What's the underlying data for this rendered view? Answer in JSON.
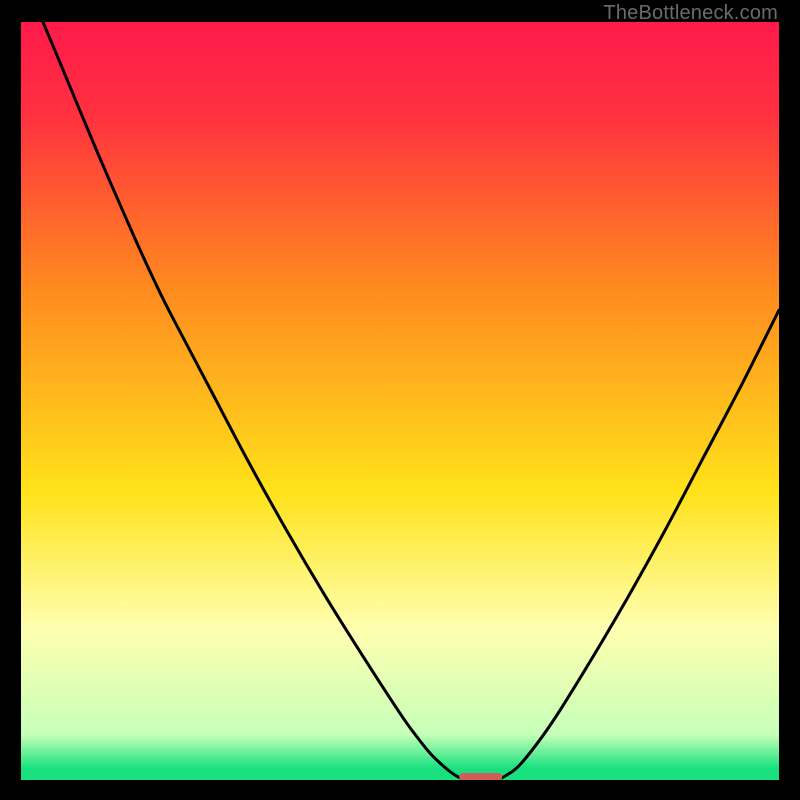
{
  "watermark": "TheBottleneck.com",
  "colors": {
    "red": "#ff1a4b",
    "orange": "#ff8a1f",
    "yellow": "#ffe21a",
    "pale_yellow": "#ffffb0",
    "green": "#18e07e",
    "marker": "#cf5e54",
    "black": "#000000"
  },
  "chart_data": {
    "type": "line",
    "title": "",
    "xlabel": "",
    "ylabel": "",
    "xlim": [
      0,
      100
    ],
    "ylim": [
      0,
      100
    ],
    "series": [
      {
        "name": "left-curve",
        "x": [
          2.9,
          5,
          10,
          15,
          18,
          20,
          25,
          30,
          35,
          40,
          45,
          50,
          52,
          54,
          56,
          57.5,
          58.5
        ],
        "y": [
          100,
          95,
          83,
          71.5,
          65,
          61,
          51.5,
          42,
          33,
          24.5,
          16.5,
          8.8,
          6,
          3.5,
          1.6,
          0.5,
          0.1
        ]
      },
      {
        "name": "right-curve",
        "x": [
          63,
          64,
          66,
          70,
          75,
          80,
          85,
          90,
          95,
          100
        ],
        "y": [
          0.1,
          0.6,
          2.2,
          7.5,
          15.5,
          24,
          33,
          42.5,
          52,
          62
        ]
      }
    ],
    "marker": {
      "name": "bottleneck-marker",
      "x_start": 57.8,
      "x_end": 63.5,
      "y": 0.4
    },
    "gradient_stops": [
      {
        "pct": 0,
        "color": "#ff1a4b"
      },
      {
        "pct": 12,
        "color": "#ff3040"
      },
      {
        "pct": 35,
        "color": "#ff8a1f"
      },
      {
        "pct": 62,
        "color": "#ffe21a"
      },
      {
        "pct": 80,
        "color": "#ffffb0"
      },
      {
        "pct": 94,
        "color": "#c6ffb8"
      },
      {
        "pct": 98.5,
        "color": "#18e07e"
      },
      {
        "pct": 100,
        "color": "#18e07e"
      }
    ]
  }
}
